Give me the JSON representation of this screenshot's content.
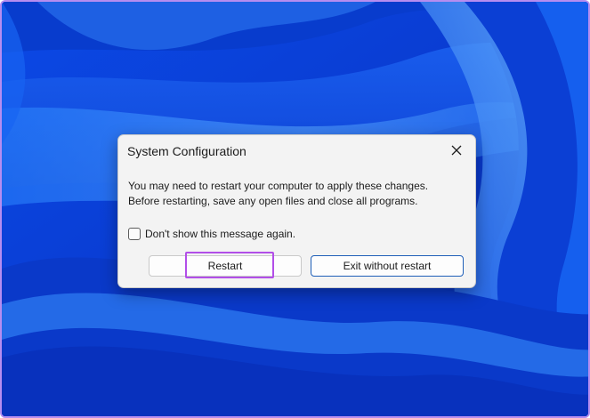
{
  "dialog": {
    "title": "System Configuration",
    "message_line1": "You may need to restart your computer to apply these changes.",
    "message_line2": "Before restarting, save any open files and close all programs.",
    "checkbox_label": "Don't show this message again.",
    "checkbox_checked": false,
    "restart_label": "Restart",
    "exit_label": "Exit without restart"
  },
  "colors": {
    "wallpaper_accent": "#1e6cff",
    "highlight": "#b24ee8",
    "default_button_border": "#1f5fb8"
  },
  "icons": {
    "close": "close-icon"
  }
}
